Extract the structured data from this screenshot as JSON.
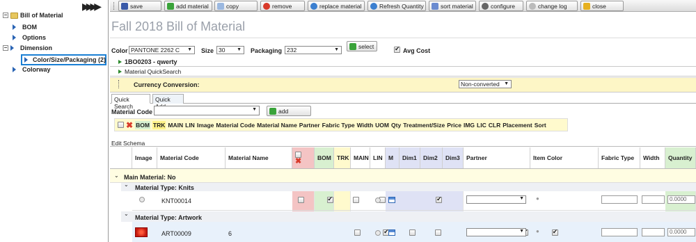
{
  "tree": {
    "root": "Bill of Material",
    "items": [
      "BOM",
      "Options",
      "Dimension",
      "Color/Size/Packaging (2)",
      "Colorway"
    ]
  },
  "toolbar": {
    "save": "save",
    "add_material": "add material",
    "copy": "copy",
    "remove": "remove",
    "replace_material": "replace material",
    "refresh_quantity": "Refresh Quantity",
    "sort_material": "sort material",
    "configure": "configure",
    "change_log": "change log",
    "close": "close"
  },
  "page_title": "Fall 2018 Bill of Material",
  "filters": {
    "color_label": "Color",
    "color_value": "PANTONE 2262 C",
    "size_label": "Size",
    "size_value": "30",
    "packaging_label": "Packaging",
    "packaging_value": "232",
    "select_label": "select",
    "avg_cost_label": "Avg Cost"
  },
  "sections": {
    "item_code": "1BO0203 - qwerty",
    "quicksearch": "Material QuickSearch",
    "currency_label": "Currency Conversion:",
    "currency_value": "Non-converted"
  },
  "tabs": [
    "Quick Search",
    "Quick Add"
  ],
  "quick_search": {
    "material_code_label": "Material Code",
    "add_label": "add",
    "columns": [
      "BOM",
      "TRK",
      "MAIN",
      "LIN",
      "Image",
      "Material Code",
      "Material Name",
      "Partner",
      "Fabric Type",
      "Width",
      "UOM",
      "Qty",
      "Treatment/Size",
      "Price",
      "IMG",
      "LIC",
      "CLR",
      "Placement",
      "Sort"
    ]
  },
  "edit_schema": "Edit Schema",
  "grid": {
    "headers": [
      "Image",
      "Material Code",
      "Material Name",
      "",
      "BOM",
      "TRK",
      "MAIN",
      "LIN",
      "M",
      "Dim1",
      "Dim2",
      "Dim3",
      "Partner",
      "Item Color",
      "Fabric Type",
      "Width",
      "Quantity"
    ],
    "group": "Main Material: No",
    "subgroups": [
      {
        "label": "Material Type: Knits",
        "code": "KNT00014",
        "name": "",
        "quantity": "0.0000"
      },
      {
        "label": "Material Type: Artwork",
        "code": "ART00009",
        "name": "6",
        "quantity": "0.0000"
      }
    ]
  },
  "colors": {
    "accent": "#2a64b4",
    "yellow": "#fffacd",
    "pink": "#f4c4c4",
    "green": "#d8f0d0",
    "purple": "#dfe2f5"
  }
}
